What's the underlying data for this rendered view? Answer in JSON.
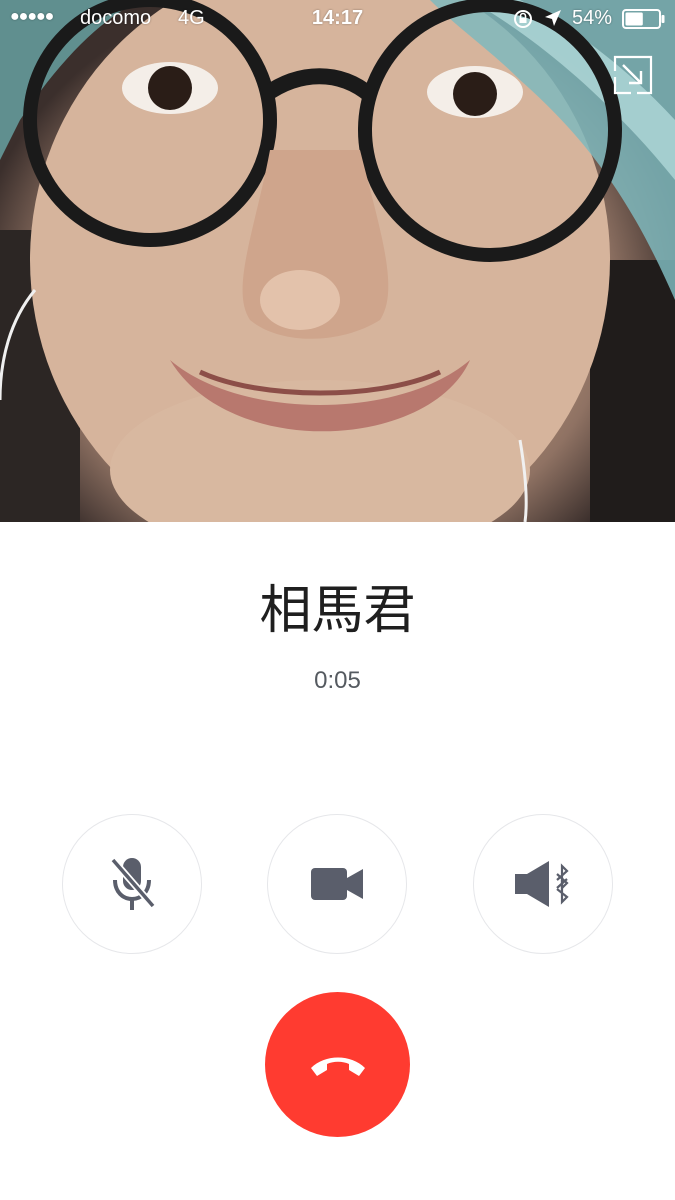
{
  "status_bar": {
    "signal_dots": "●●●●●",
    "carrier": "docomo",
    "network": "4G",
    "time": "14:17",
    "battery_percent": "54%",
    "battery_level": 0.54,
    "icons": [
      "signal-icon",
      "orientation-lock-icon",
      "location-arrow-icon",
      "battery-icon"
    ]
  },
  "video": {
    "icon": "minimize-video-icon"
  },
  "call": {
    "caller_name": "相馬君",
    "duration": "0:05"
  },
  "controls": [
    {
      "name": "mute",
      "icon": "microphone-muted-icon"
    },
    {
      "name": "video",
      "icon": "video-camera-icon"
    },
    {
      "name": "speaker",
      "icon": "speaker-bluetooth-icon"
    },
    {
      "name": "end-call",
      "icon": "phone-hangup-icon"
    }
  ],
  "colors": {
    "end_call": "#FF3B30",
    "control_icon": "#5A5E6B",
    "control_border": "#E6E7EA",
    "caller_text": "#1F1F1F",
    "timer_text": "#555A60"
  }
}
